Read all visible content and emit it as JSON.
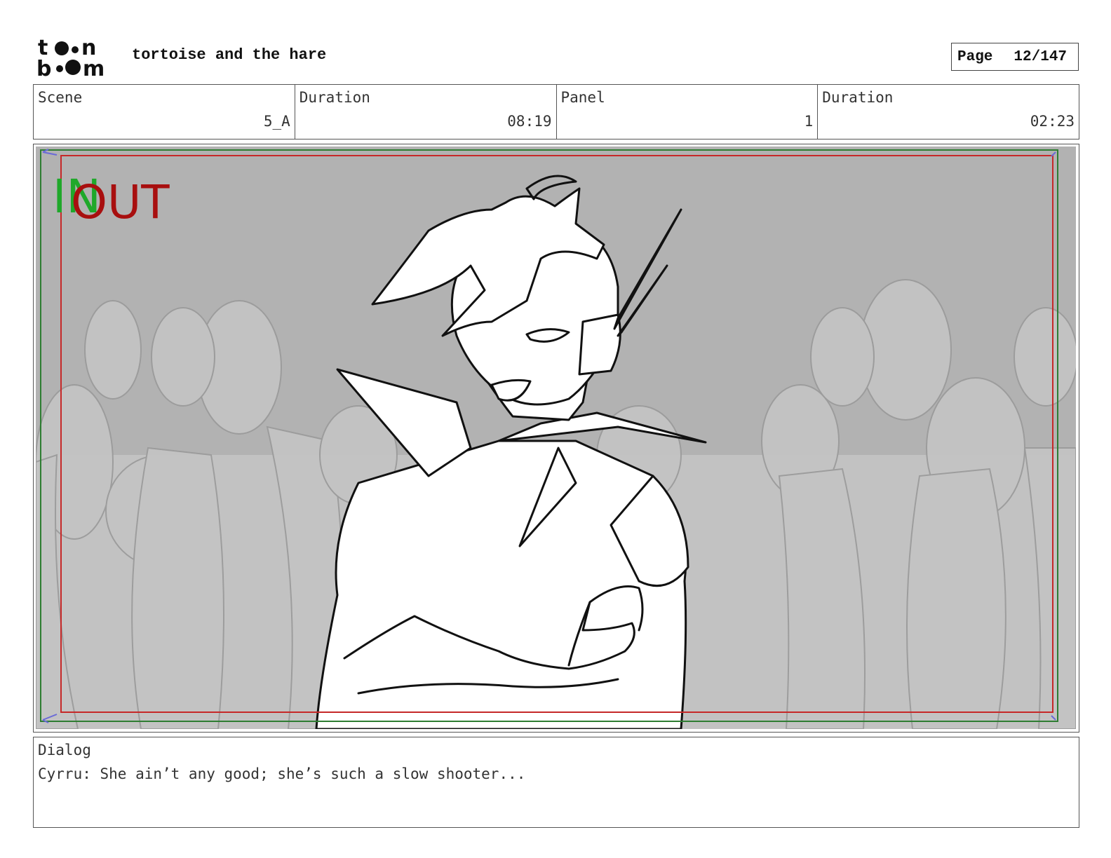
{
  "header": {
    "logo_text_top": "toon",
    "logo_text_bottom": "boom",
    "project_title": "tortoise and the hare",
    "page_label": "Page",
    "page_value": "12/147"
  },
  "info": [
    {
      "label": "Scene",
      "value": "5_A"
    },
    {
      "label": "Duration",
      "value": "08:19"
    },
    {
      "label": "Panel",
      "value": "1"
    },
    {
      "label": "Duration",
      "value": "02:23"
    }
  ],
  "panel": {
    "in_marker": "IN",
    "out_marker": "OUT",
    "colors": {
      "in": "#1fa82a",
      "out": "#a80f0f",
      "frame_green": "#2e7d32",
      "frame_red": "#c62828",
      "background": "#b2b2b2"
    }
  },
  "dialog": {
    "label": "Dialog",
    "text": "Cyrru: She ain’t any good; she’s such a slow shooter..."
  }
}
